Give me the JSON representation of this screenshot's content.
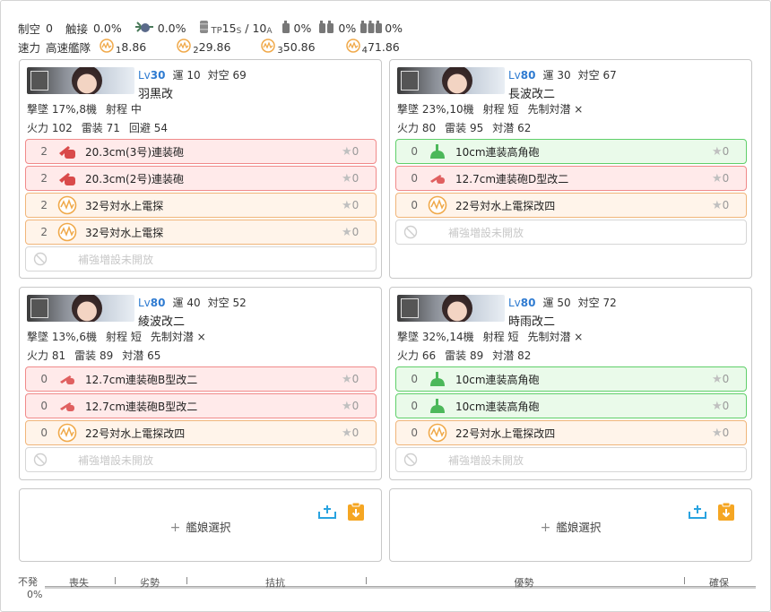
{
  "summary": {
    "air_label": "制空",
    "air_value": "0",
    "contact_label": "触接",
    "contact_value": "0.0%",
    "recon_value": "0.0%",
    "tp_prefix": "TP",
    "tp_s": "15",
    "tp_s_sub": "S",
    "tp_sep": " / ",
    "tp_a": "10",
    "tp_a_sub": "A",
    "drum1": "0%",
    "drum2": "0%",
    "drum3": "0%",
    "speed_label": "速力",
    "speed_value": "高速艦隊",
    "los": [
      {
        "sub": "1",
        "value": "8.86"
      },
      {
        "sub": "2",
        "value": "29.86"
      },
      {
        "sub": "3",
        "value": "50.86"
      },
      {
        "sub": "4",
        "value": "71.86"
      }
    ]
  },
  "ships": [
    {
      "lv_prefix": "Lv",
      "lv": "30",
      "luck_label": "運",
      "luck": "10",
      "aa_label": "対空",
      "aa": "69",
      "name": "羽黒改",
      "line1": {
        "aa_cutin_label": "撃墜",
        "aa_cutin": "17%,8機",
        "range_label": "射程",
        "range": "中",
        "asw_first": ""
      },
      "line2": {
        "fp_label": "火力",
        "fp": "102",
        "tp_label": "雷装",
        "tp": "71",
        "third_label": "回避",
        "third": "54"
      },
      "slots": [
        {
          "count": "2",
          "name": "20.3cm(3号)連装砲",
          "star": "0",
          "kind": "red",
          "icon": "big-gun"
        },
        {
          "count": "2",
          "name": "20.3cm(2号)連装砲",
          "star": "0",
          "kind": "red",
          "icon": "big-gun"
        },
        {
          "count": "2",
          "name": "32号対水上電探",
          "star": "0",
          "kind": "orange",
          "icon": "radar"
        },
        {
          "count": "2",
          "name": "32号対水上電探",
          "star": "0",
          "kind": "orange",
          "icon": "radar"
        }
      ],
      "ex_slot": "補強増設未開放"
    },
    {
      "lv_prefix": "Lv",
      "lv": "80",
      "luck_label": "運",
      "luck": "30",
      "aa_label": "対空",
      "aa": "67",
      "name": "長波改二",
      "line1": {
        "aa_cutin_label": "撃墜",
        "aa_cutin": "23%,10機",
        "range_label": "射程",
        "range": "短",
        "asw_first": "先制対潜 ×"
      },
      "line2": {
        "fp_label": "火力",
        "fp": "80",
        "tp_label": "雷装",
        "tp": "95",
        "third_label": "対潜",
        "third": "62"
      },
      "slots": [
        {
          "count": "0",
          "name": "10cm連装高角砲",
          "star": "0",
          "kind": "green",
          "icon": "aa-gun"
        },
        {
          "count": "0",
          "name": "12.7cm連装砲D型改二",
          "star": "0",
          "kind": "red",
          "icon": "small-gun"
        },
        {
          "count": "0",
          "name": "22号対水上電探改四",
          "star": "0",
          "kind": "orange",
          "icon": "radar"
        }
      ],
      "ex_slot": "補強増設未開放"
    },
    {
      "lv_prefix": "Lv",
      "lv": "80",
      "luck_label": "運",
      "luck": "40",
      "aa_label": "対空",
      "aa": "52",
      "name": "綾波改二",
      "line1": {
        "aa_cutin_label": "撃墜",
        "aa_cutin": "13%,6機",
        "range_label": "射程",
        "range": "短",
        "asw_first": "先制対潜 ×"
      },
      "line2": {
        "fp_label": "火力",
        "fp": "81",
        "tp_label": "雷装",
        "tp": "89",
        "third_label": "対潜",
        "third": "65"
      },
      "slots": [
        {
          "count": "0",
          "name": "12.7cm連装砲B型改二",
          "star": "0",
          "kind": "red",
          "icon": "small-gun"
        },
        {
          "count": "0",
          "name": "12.7cm連装砲B型改二",
          "star": "0",
          "kind": "red",
          "icon": "small-gun"
        },
        {
          "count": "0",
          "name": "22号対水上電探改四",
          "star": "0",
          "kind": "orange",
          "icon": "radar"
        }
      ],
      "ex_slot": "補強増設未開放"
    },
    {
      "lv_prefix": "Lv",
      "lv": "80",
      "luck_label": "運",
      "luck": "50",
      "aa_label": "対空",
      "aa": "72",
      "name": "時雨改二",
      "line1": {
        "aa_cutin_label": "撃墜",
        "aa_cutin": "32%,14機",
        "range_label": "射程",
        "range": "短",
        "asw_first": "先制対潜 ×"
      },
      "line2": {
        "fp_label": "火力",
        "fp": "66",
        "tp_label": "雷装",
        "tp": "89",
        "third_label": "対潜",
        "third": "82"
      },
      "slots": [
        {
          "count": "0",
          "name": "10cm連装高角砲",
          "star": "0",
          "kind": "green",
          "icon": "aa-gun"
        },
        {
          "count": "0",
          "name": "10cm連装高角砲",
          "star": "0",
          "kind": "green",
          "icon": "aa-gun"
        },
        {
          "count": "0",
          "name": "22号対水上電探改四",
          "star": "0",
          "kind": "orange",
          "icon": "radar"
        }
      ],
      "ex_slot": "補強増設未開放"
    }
  ],
  "add_ship": {
    "label": "艦娘選択",
    "plus": "+"
  },
  "gauge": {
    "left_label": "不発",
    "left_value": "0%",
    "segments": [
      "喪失",
      "劣勢",
      "拮抗",
      "優勢",
      "確保"
    ]
  },
  "colors": {
    "lv": "#2f7bd1",
    "red_slot": "#ffeaea",
    "orange_slot": "#fff4ea",
    "green_slot": "#eafaea",
    "accent_blue": "#29a3e0",
    "accent_orange": "#f5a623"
  }
}
